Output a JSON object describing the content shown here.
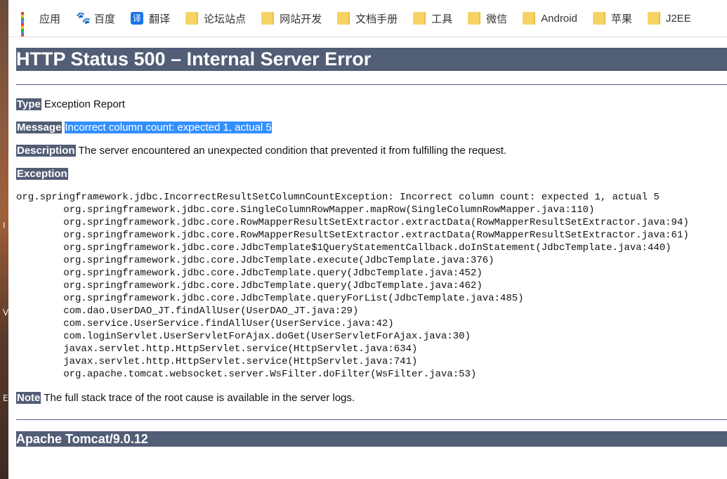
{
  "bookmarks": [
    {
      "label": "应用",
      "icon": "apps-icon"
    },
    {
      "label": "百度",
      "icon": "baidu-icon"
    },
    {
      "label": "翻译",
      "icon": "translate-icon"
    },
    {
      "label": "论坛站点",
      "icon": "folder-icon"
    },
    {
      "label": "网站开发",
      "icon": "folder-icon"
    },
    {
      "label": "文档手册",
      "icon": "folder-icon"
    },
    {
      "label": "工具",
      "icon": "folder-icon"
    },
    {
      "label": "微信",
      "icon": "folder-icon"
    },
    {
      "label": "Android",
      "icon": "folder-icon"
    },
    {
      "label": "苹果",
      "icon": "folder-icon"
    },
    {
      "label": "J2EE",
      "icon": "folder-icon"
    }
  ],
  "translate_glyph": "译",
  "baidu_glyph": "🐾",
  "page": {
    "title": "HTTP Status 500 – Internal Server Error",
    "type_label": "Type",
    "type_value": "Exception Report",
    "message_label": "Message",
    "message_value": "Incorrect column count: expected 1, actual 5",
    "description_label": "Description",
    "description_value": "The server encountered an unexpected condition that prevented it from fulfilling the request.",
    "exception_label": "Exception",
    "exception_trace": "org.springframework.jdbc.IncorrectResultSetColumnCountException: Incorrect column count: expected 1, actual 5\n\torg.springframework.jdbc.core.SingleColumnRowMapper.mapRow(SingleColumnRowMapper.java:110)\n\torg.springframework.jdbc.core.RowMapperResultSetExtractor.extractData(RowMapperResultSetExtractor.java:94)\n\torg.springframework.jdbc.core.RowMapperResultSetExtractor.extractData(RowMapperResultSetExtractor.java:61)\n\torg.springframework.jdbc.core.JdbcTemplate$1QueryStatementCallback.doInStatement(JdbcTemplate.java:440)\n\torg.springframework.jdbc.core.JdbcTemplate.execute(JdbcTemplate.java:376)\n\torg.springframework.jdbc.core.JdbcTemplate.query(JdbcTemplate.java:452)\n\torg.springframework.jdbc.core.JdbcTemplate.query(JdbcTemplate.java:462)\n\torg.springframework.jdbc.core.JdbcTemplate.queryForList(JdbcTemplate.java:485)\n\tcom.dao.UserDAO_JT.findAllUser(UserDAO_JT.java:29)\n\tcom.service.UserService.findAllUser(UserService.java:42)\n\tcom.loginServlet.UserServletForAjax.doGet(UserServletForAjax.java:30)\n\tjavax.servlet.http.HttpServlet.service(HttpServlet.java:634)\n\tjavax.servlet.http.HttpServlet.service(HttpServlet.java:741)\n\torg.apache.tomcat.websocket.server.WsFilter.doFilter(WsFilter.java:53)",
    "note_label": "Note",
    "note_value": "The full stack trace of the root cause is available in the server logs.",
    "footer": "Apache Tomcat/9.0.12"
  },
  "colors": {
    "header_bg": "#525d76",
    "selection": "#3390ff",
    "folder": "#f6d365"
  }
}
